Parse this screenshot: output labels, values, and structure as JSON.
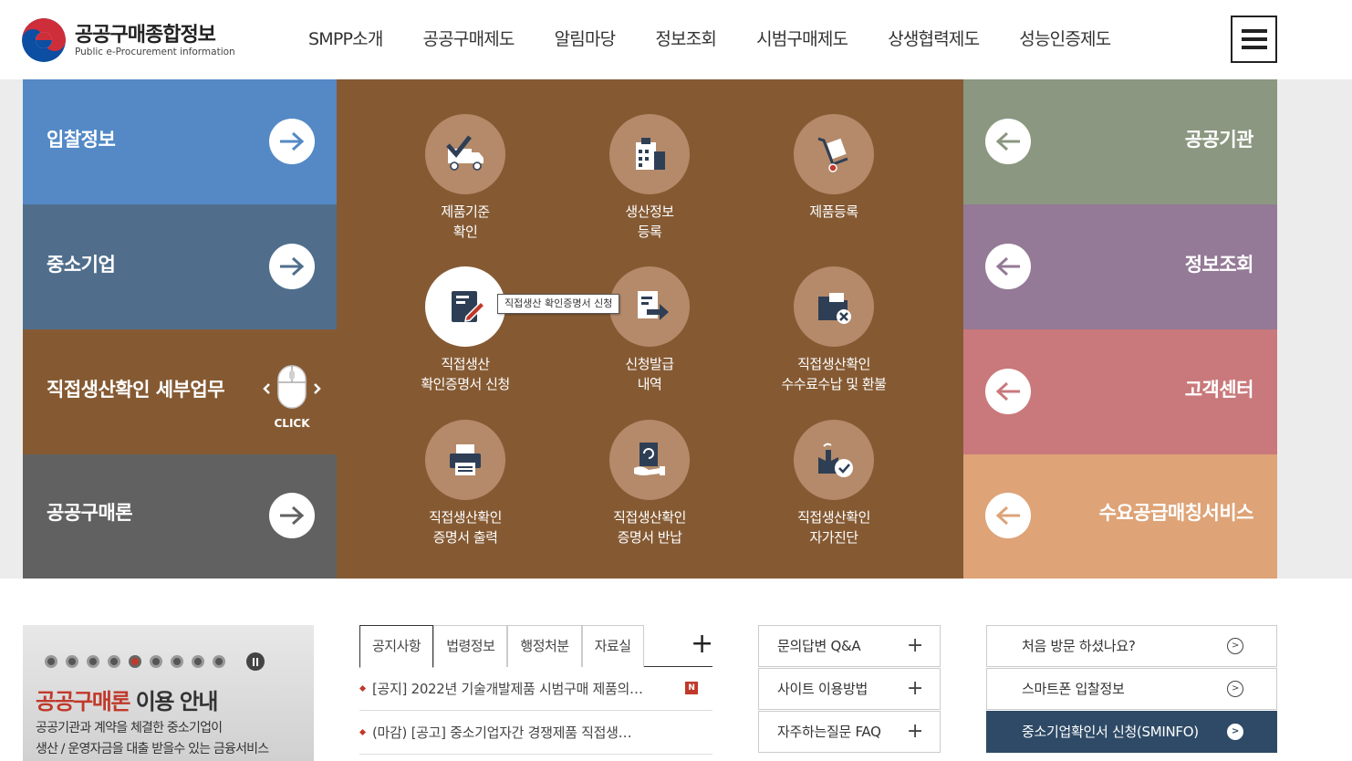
{
  "header": {
    "logo_title": "공공구매종합정보",
    "logo_sub": "Public e-Procurement information",
    "nav": [
      "SMPP소개",
      "공공구매제도",
      "알림마당",
      "정보조회",
      "시범구매제도",
      "상생협력제도",
      "성능인증제도"
    ]
  },
  "left_panels": [
    {
      "title": "입찰정보",
      "color": "#5489c6"
    },
    {
      "title": "중소기업",
      "color": "#506e8c"
    },
    {
      "title": "직접생산확인 세부업무",
      "color": "#855a33",
      "click_label": "CLICK"
    },
    {
      "title": "공공구매론",
      "color": "#616161"
    }
  ],
  "services": [
    {
      "label1": "제품기준",
      "label2": "확인",
      "icon": "truck-check-icon"
    },
    {
      "label1": "생산정보",
      "label2": "등록",
      "icon": "building-clipboard-icon"
    },
    {
      "label1": "제품등록",
      "label2": "",
      "icon": "hand-truck-icon"
    },
    {
      "label1": "직접생산",
      "label2": "확인증명서 신청",
      "icon": "document-pen-icon"
    },
    {
      "label1": "신청발급",
      "label2": "내역",
      "icon": "document-arrow-icon"
    },
    {
      "label1": "직접생산확인",
      "label2": "수수료수납 및 환불",
      "icon": "folder-cancel-icon"
    },
    {
      "label1": "직접생산확인",
      "label2": "증명서 출력",
      "icon": "printer-icon"
    },
    {
      "label1": "직접생산확인",
      "label2": "증명서 반납",
      "icon": "document-return-icon"
    },
    {
      "label1": "직접생산확인",
      "label2": "자가진단",
      "icon": "factory-check-icon"
    }
  ],
  "tooltip": "직접생산 확인증명서 신청",
  "right_panels": [
    {
      "title": "공공기관",
      "color": "#8b9780"
    },
    {
      "title": "정보조회",
      "color": "#947a96"
    },
    {
      "title": "고객센터",
      "color": "#c9797b"
    },
    {
      "title": "수요공급매칭서비스",
      "color": "#dea377"
    }
  ],
  "banner": {
    "title_red": "공공구매론",
    "title_rest": " 이용 안내",
    "desc1": "공공기관과 계약을 체결한 중소기업이",
    "desc2": "생산 / 운영자금을 대출 받을수 있는 금융서비스"
  },
  "tabs": [
    "공지사항",
    "법령정보",
    "행정처분",
    "자료실"
  ],
  "news": [
    {
      "text": "[공지] 2022년 기술개발제품 시범구매 제품의…",
      "badge": "N"
    },
    {
      "text": "(마감) [공고] 중소기업자간 경쟁제품 직접생…",
      "badge": ""
    }
  ],
  "faq": [
    "문의답변 Q&A",
    "사이트 이용방법",
    "자주하는질문 FAQ"
  ],
  "quick": [
    "처음 방문 하셨나요?",
    "스마트폰 입찰정보",
    "중소기업확인서 신청(SMINFO)"
  ]
}
